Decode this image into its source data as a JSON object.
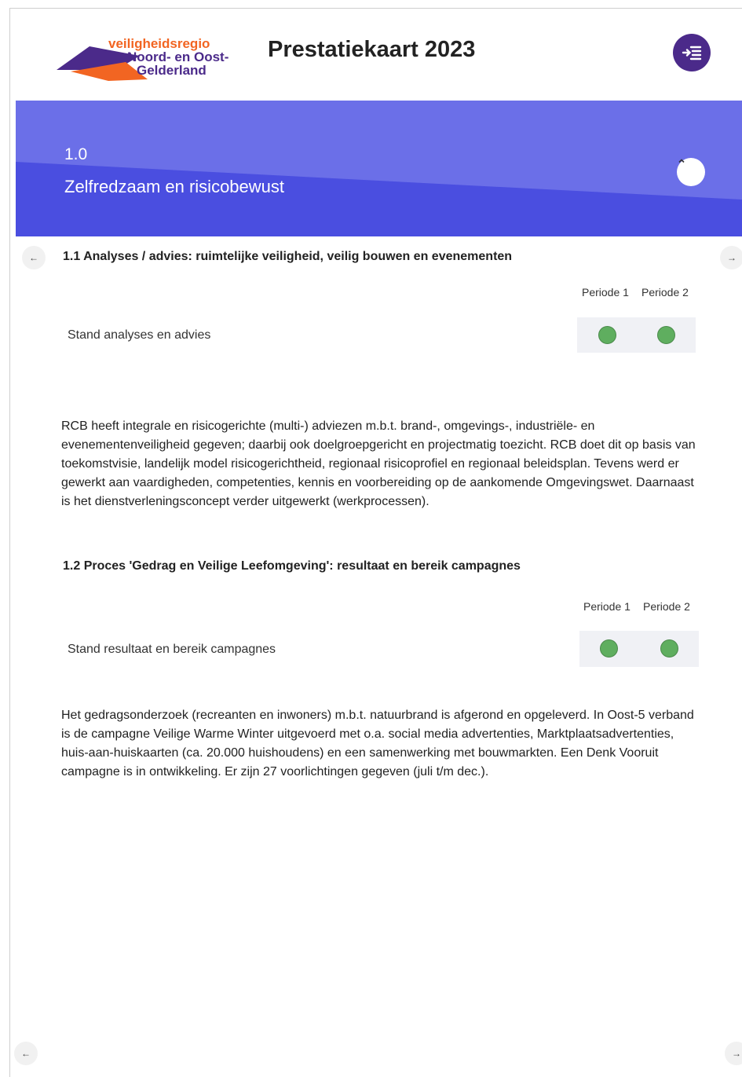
{
  "header": {
    "logo": {
      "line1": "veiligheidsregio",
      "line2": "Noord- en Oost-",
      "line3": "Gelderland"
    },
    "title": "Prestatiekaart 2023",
    "menu_icon": "indent-list-icon"
  },
  "banner": {
    "number": "1.0",
    "title": "Zelfredzaam en risicobewust",
    "colors": {
      "primary": "#4a4ee0",
      "light": "#6b6fe8"
    }
  },
  "sections": [
    {
      "heading": "1.1 Analyses / advies: ruimtelijke veiligheid, veilig bouwen en evenementen",
      "periods": [
        "Periode 1",
        "Periode 2"
      ],
      "indicator_label": "Stand analyses en advies",
      "statuses": [
        "green",
        "green"
      ],
      "text": "RCB heeft integrale en risicogerichte (multi-) adviezen m.b.t. brand-, omgevings-, industriële- en evenementenveiligheid gegeven; daarbij ook doelgroepgericht en projectmatig toezicht. RCB doet dit op basis van toekomstvisie, landelijk model risicogerichtheid, regionaal risicoprofiel en regionaal beleidsplan. Tevens werd er gewerkt aan vaardigheden, competenties, kennis en voorbereiding op de aankomende Omgevingswet. Daarnaast is het dienstverleningsconcept verder uitgewerkt (werkprocessen)."
    },
    {
      "heading": "1.2 Proces 'Gedrag en Veilige Leefomgeving': resultaat en bereik campagnes",
      "periods": [
        "Periode 1",
        "Periode 2"
      ],
      "indicator_label": "Stand resultaat en bereik campagnes",
      "statuses": [
        "green",
        "green"
      ],
      "text": "Het gedragsonderzoek (recreanten en inwoners) m.b.t. natuurbrand is afgerond en opgeleverd. In Oost-5 verband is de campagne Veilige Warme Winter uitgevoerd met o.a. social media advertenties, Marktplaatsadvertenties, huis-aan-huiskaarten (ca. 20.000 huishoudens) en een samenwerking met bouwmarkten. Een Denk Vooruit campagne is in ontwikkeling. Er zijn 27 voorlichtingen gegeven (juli t/m dec.)."
    }
  ],
  "nav": {
    "prev_glyph": "←",
    "next_glyph": "→"
  },
  "status_colors": {
    "green": "#5fae5f"
  }
}
